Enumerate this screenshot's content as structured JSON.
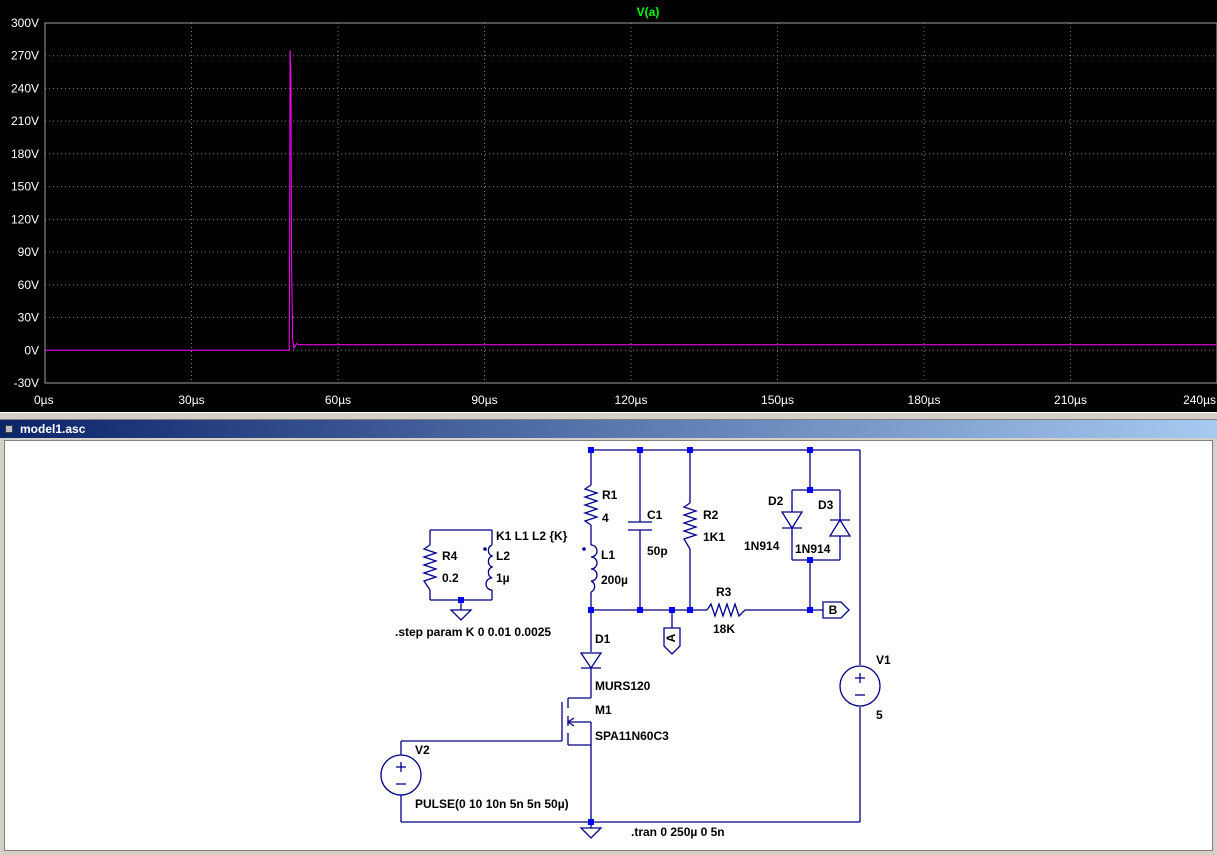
{
  "plot": {
    "trace_label": "V(a)",
    "trace_color": "#ff00ff",
    "label_color": "#00ff00",
    "y_ticks": [
      "300V",
      "270V",
      "240V",
      "210V",
      "180V",
      "150V",
      "120V",
      "90V",
      "60V",
      "30V",
      "0V",
      "-30V"
    ],
    "x_ticks": [
      "0µs",
      "30µs",
      "60µs",
      "90µs",
      "120µs",
      "150µs",
      "180µs",
      "210µs",
      "240µs"
    ]
  },
  "chart_data": {
    "type": "line",
    "title": "V(a)",
    "xlabel": "",
    "ylabel": "",
    "xlim": [
      0,
      240
    ],
    "ylim": [
      -30,
      300
    ],
    "x_unit": "µs",
    "y_unit": "V",
    "grid": true,
    "series": [
      {
        "name": "V(a)",
        "color": "#ff00ff",
        "x": [
          0,
          49.0,
          50.0,
          50.1,
          50.2,
          50.35,
          50.5,
          50.7,
          51.0,
          51.5,
          52,
          240
        ],
        "y": [
          0,
          0,
          0,
          100,
          275,
          250,
          80,
          10,
          2,
          6,
          5,
          5
        ]
      }
    ]
  },
  "window": {
    "title": "model1.asc"
  },
  "schematic": {
    "components": {
      "r1": {
        "name": "R1",
        "value": "4"
      },
      "c1": {
        "name": "C1",
        "value": "50p"
      },
      "r2": {
        "name": "R2",
        "value": "1K1"
      },
      "d2": {
        "name": "D2",
        "value": "1N914"
      },
      "d3": {
        "name": "D3",
        "value": "1N914"
      },
      "l1": {
        "name": "L1",
        "value": "200µ"
      },
      "r3": {
        "name": "R3",
        "value": "18K"
      },
      "r4": {
        "name": "R4",
        "value": "0.2"
      },
      "l2": {
        "name": "L2",
        "value": "1µ"
      },
      "d1": {
        "name": "D1",
        "value": "MURS120"
      },
      "m1": {
        "name": "M1",
        "value": "SPA11N60C3"
      },
      "v1": {
        "name": "V1",
        "value": "5"
      },
      "v2": {
        "name": "V2",
        "value": "PULSE(0 10 10n 5n 5n 50µ)"
      }
    },
    "net_labels": {
      "a": "A",
      "b": "B"
    },
    "directives": {
      "coupling": "K1 L1 L2 {K}",
      "step": ".step param K 0 0.01 0.0025",
      "tran": ".tran 0 250µ 0 5n"
    }
  }
}
